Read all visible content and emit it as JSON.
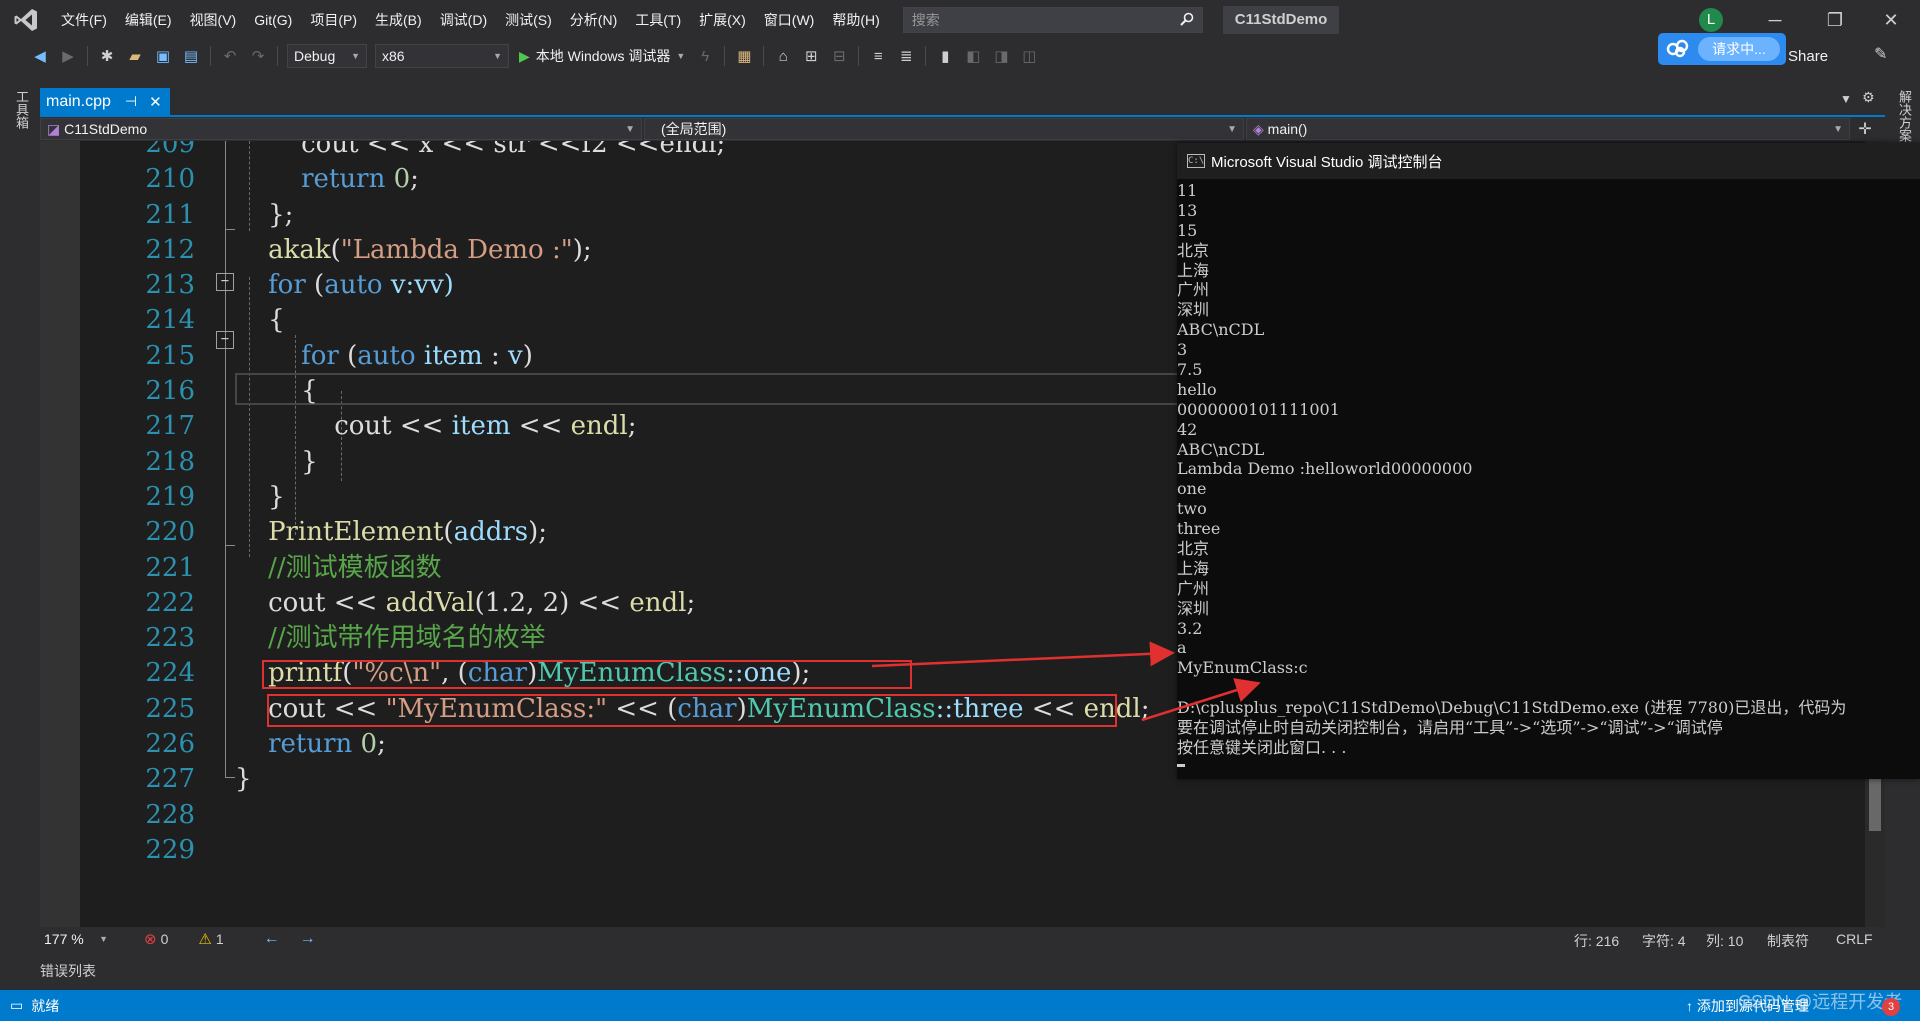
{
  "menu": {
    "items": [
      "文件(F)",
      "编辑(E)",
      "视图(V)",
      "Git(G)",
      "项目(P)",
      "生成(B)",
      "调试(D)",
      "测试(S)",
      "分析(N)",
      "工具(T)",
      "扩展(X)",
      "窗口(W)",
      "帮助(H)"
    ],
    "search_placeholder": "搜索",
    "solution_title": "C11StdDemo",
    "avatar_letter": "L"
  },
  "toolbar": {
    "config": "Debug",
    "platform": "x86",
    "run_label": "本地 Windows 调试器",
    "badge_label": "请求中...",
    "live_share": "ve Share"
  },
  "left_strip_label": "工具箱",
  "right_strip_label": "解决方案",
  "tab": {
    "label": "main.cpp",
    "pin": "⊣",
    "close": "✕"
  },
  "navbar": {
    "project": "C11StdDemo",
    "scope": "(全局范围)",
    "member": "main()"
  },
  "editor": {
    "line_numbers": [
      "209",
      "210",
      "211",
      "212",
      "213",
      "214",
      "215",
      "216",
      "217",
      "218",
      "219",
      "220",
      "221",
      "222",
      "223",
      "224",
      "225",
      "226",
      "227",
      "228",
      "229"
    ],
    "accent_colors": {
      "keyword": "#569cd6",
      "function": "#dcdcaa",
      "string": "#d69d85",
      "comment": "#57a64a",
      "type": "#4ec9b0",
      "highlight_box": "#e03030"
    }
  },
  "code_tokens": {
    "l209": [
      "cout << x << str <<f2 <<endl;"
    ],
    "l210_kw": "return",
    "l210_num": "0",
    "l211": "};",
    "l212_fn": "akak",
    "l212_str": "\"Lambda Demo :\"",
    "l213_for": "for",
    "l213_auto": "auto",
    "l213_rest": " v:vv)",
    "l214": "{",
    "l215_for": "for",
    "l215_auto": "auto",
    "l215_item": "item",
    "l215_v": "v",
    "l216": "{",
    "l217_cout": "cout << ",
    "l217_item": "item",
    "l217_endl": "endl",
    "l218": "}",
    "l219": "}",
    "l220_fn": "PrintElement",
    "l220_arg": "addrs",
    "l221_cm": "//测试模板函数",
    "l222_cout": "cout << ",
    "l222_fn": "addVal",
    "l222_args": "(1.2, 2)",
    "l222_endl": "endl",
    "l223_cm": "//测试带作用域名的枚举",
    "l224_fn": "printf",
    "l224_str": "\"%c\\n\"",
    "l224_char": "char",
    "l224_type": "MyEnumClass",
    "l224_member": "::one",
    "l225_cout": "cout << ",
    "l225_str": "\"MyEnumClass:\"",
    "l225_char": "char",
    "l225_type": "MyEnumClass",
    "l225_member": "::three",
    "l225_endl": "endl",
    "l226_kw": "return",
    "l226_num": "0",
    "l227": "}"
  },
  "console": {
    "title": "Microsoft Visual Studio 调试控制台",
    "lines": [
      "11",
      "13",
      "15",
      "北京",
      "上海",
      "广州",
      "深圳",
      "ABC\\nCDL",
      "3",
      "7.5",
      "hello",
      "0000000101111001",
      "42",
      "ABC\\nCDL",
      "Lambda Demo :helloworld00000000",
      "one",
      "two",
      "three",
      "北京",
      "上海",
      "广州",
      "深圳",
      "3.2",
      "a",
      "MyEnumClass:c",
      "",
      "D:\\cplusplus_repo\\C11StdDemo\\Debug\\C11StdDemo.exe (进程 7780)已退出，代码为",
      "要在调试停止时自动关闭控制台，请启用“工具”->“选项”->“调试”->“调试停",
      "按任意键关闭此窗口. . ."
    ]
  },
  "editbar": {
    "zoom": "177 %",
    "errors": "0",
    "warnings": "1",
    "line": "行: 216",
    "char": "字符: 4",
    "col": "列: 10",
    "tabs": "制表符",
    "eol": "CRLF"
  },
  "error_list_tab": "错误列表",
  "status": {
    "ready": "就绪",
    "add_source": "添加到源代码管理",
    "watermark": "CSDN @远程开发者",
    "badge": "3"
  }
}
